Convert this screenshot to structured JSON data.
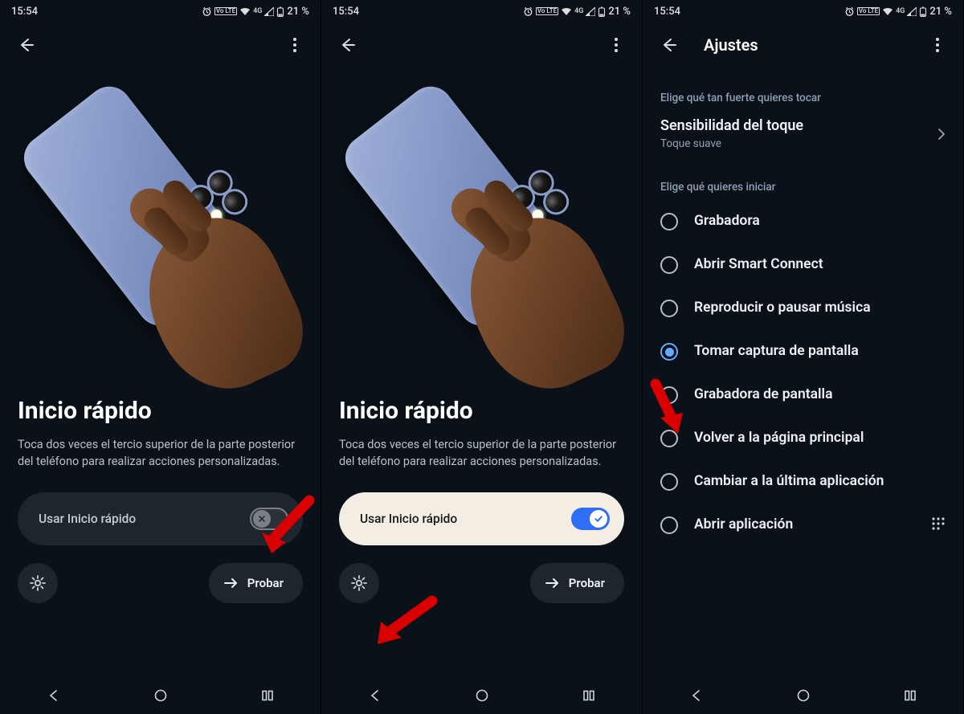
{
  "status": {
    "time": "15:54",
    "network_label": "Vo LTE",
    "signal_label": "4G",
    "battery_text": "21 %"
  },
  "screen12": {
    "title": "Inicio rápido",
    "description": "Toca dos veces el tercio superior de la parte posterior del teléfono para realizar acciones personalizadas.",
    "toggle_label": "Usar Inicio rápido",
    "try_label": "Probar"
  },
  "screen3": {
    "title": "Ajustes",
    "sensitivity_caption": "Elige qué tan fuerte quieres tocar",
    "sensitivity_title": "Sensibilidad del toque",
    "sensitivity_value": "Toque suave",
    "actions_caption": "Elige qué quieres iniciar",
    "options": [
      {
        "label": "Grabadora",
        "checked": false
      },
      {
        "label": "Abrir Smart Connect",
        "checked": false
      },
      {
        "label": "Reproducir o pausar música",
        "checked": false
      },
      {
        "label": "Tomar captura de pantalla",
        "checked": true
      },
      {
        "label": "Grabadora de pantalla",
        "checked": false
      },
      {
        "label": "Volver a la página principal",
        "checked": false
      },
      {
        "label": "Cambiar a la última aplicación",
        "checked": false
      },
      {
        "label": "Abrir aplicación",
        "checked": false,
        "extra": true
      }
    ]
  }
}
